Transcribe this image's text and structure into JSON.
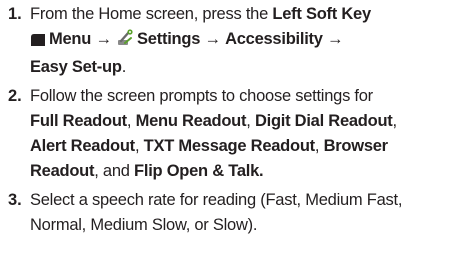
{
  "steps": [
    {
      "number": "1.",
      "intro": "From the Home screen, press the ",
      "soft_key": "Left Soft Key",
      "menu": "Menu",
      "settings": "Settings",
      "accessibility": "Accessibility",
      "arrow": "→",
      "easy_setup": "Easy Set-up",
      "end": ".",
      "icons": [
        "soft-key",
        "settings-wrench"
      ]
    },
    {
      "number": "2.",
      "intro": "Follow the screen prompts to choose settings for ",
      "items": [
        "Full Readout",
        "Menu Readout",
        "Digit Dial Readout",
        "Alert Readout",
        "TXT Message Readout",
        "Browser Readout"
      ],
      "sep": ", ",
      "and": ", and ",
      "last": "Flip Open & Talk."
    },
    {
      "number": "3.",
      "text": "Select a speech rate for reading (Fast, Medium Fast, Normal, Medium Slow, or Slow)."
    }
  ],
  "colors": {
    "text": "#231f20",
    "soft_key_icon": "#231f20",
    "wrench_green": "#5aa02c"
  }
}
